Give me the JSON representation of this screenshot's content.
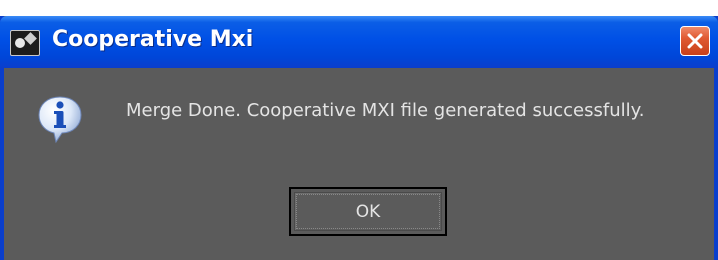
{
  "window": {
    "title": "Cooperative Mxi",
    "app_icon": "app-icon",
    "close_icon": "close-icon"
  },
  "dialog": {
    "icon": "info-icon",
    "message": "Merge Done. Cooperative MXI file generated successfully.",
    "ok_label": "OK"
  },
  "colors": {
    "titlebar": "#0050e6",
    "body": "#5b5b5b",
    "text": "#e4e4e4",
    "close_button": "#e05a32"
  }
}
